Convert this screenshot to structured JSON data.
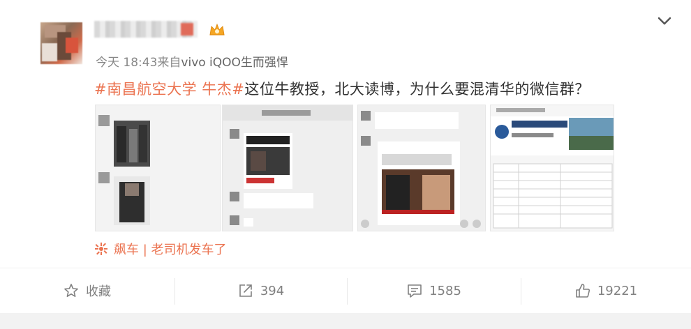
{
  "header": {
    "meta_time": "今天 18:43",
    "meta_from": "来自",
    "meta_source": "vivo iQOO生而强悍"
  },
  "post": {
    "hashtag": "#南昌航空大学 牛杰#",
    "text": "这位牛教授，北大读博，为什么要混清华的微信群？"
  },
  "repost_tag": {
    "label": "飙车",
    "sep": "|",
    "sublabel": "老司机发车了"
  },
  "actions": {
    "favorite_label": "收藏",
    "repost_count": "394",
    "comment_count": "1585",
    "like_count": "19221"
  },
  "colors": {
    "accent": "#eb7350",
    "muted": "#808080"
  },
  "icons": [
    "crown-icon",
    "chevron-down-icon",
    "gear-icon",
    "star-icon",
    "share-icon",
    "comment-icon",
    "thumbs-up-icon"
  ]
}
